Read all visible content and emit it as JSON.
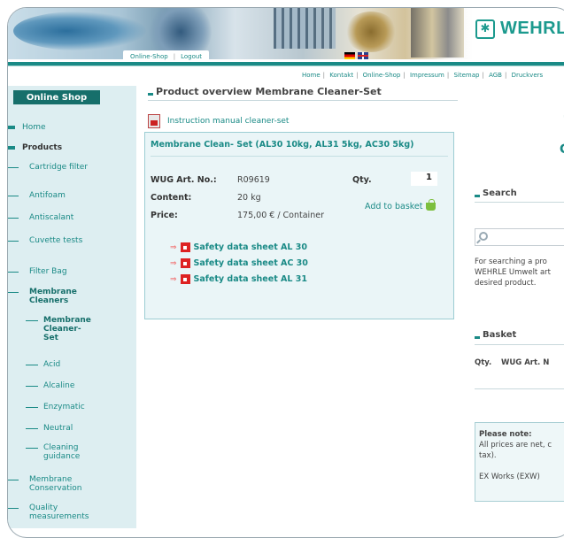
{
  "header": {
    "logo_text": "WEHRLE",
    "top_links": [
      "Online-Shop",
      "Logout"
    ]
  },
  "subnav": [
    "Home",
    "Kontakt",
    "Online-Shop",
    "Impressum",
    "Sitemap",
    "AGB",
    "Druckvers"
  ],
  "sidebar": {
    "heading": "Online Shop",
    "items": [
      {
        "label": "Home",
        "level": 0
      },
      {
        "label": "Products",
        "level": 0
      },
      {
        "label": "Cartridge filter",
        "level": 1
      },
      {
        "label": "Antifoam",
        "level": 1
      },
      {
        "label": "Antiscalant",
        "level": 1
      },
      {
        "label": "Cuvette tests",
        "level": 1
      },
      {
        "label": "Filter Bag",
        "level": 1
      },
      {
        "label": "Membrane Cleaners",
        "level": 1
      },
      {
        "label": "Membrane Cleaner-Set",
        "level": 2
      },
      {
        "label": "Acid",
        "level": 2
      },
      {
        "label": "Alcaline",
        "level": 2
      },
      {
        "label": "Enzymatic",
        "level": 2
      },
      {
        "label": "Neutral",
        "level": 2
      },
      {
        "label": "Cleaning guidance",
        "level": 2
      },
      {
        "label": "Membrane Conservation",
        "level": 1
      },
      {
        "label": "Quality measurements",
        "level": 1
      }
    ]
  },
  "main": {
    "title": "Product overview Membrane Cleaner-Set",
    "manual_link": "Instruction manual cleaner-set",
    "product": {
      "name": "Membrane Clean- Set (AL30 10kg, AL31 5kg, AC30 5kg)",
      "art_label": "WUG Art. No.:",
      "art_value": "R09619",
      "qty_label": "Qty.",
      "qty_value": "1",
      "content_label": "Content:",
      "content_value": "20 kg",
      "price_label": "Price:",
      "price_value": "175,00 € / Container",
      "add_to_basket": "Add to basket"
    },
    "safety_sheets": [
      "Safety data sheet AL 30",
      "Safety data sheet AC 30",
      "Safety data sheet AL 31"
    ]
  },
  "right": {
    "partial_1": "'",
    "partial_2": "C",
    "search_heading": "Search",
    "search_text_1": "For searching a pro",
    "search_text_2": "WEHRLE Umwelt art",
    "search_text_3": "desired product.",
    "basket_heading": "Basket",
    "basket_qty": "Qty.",
    "basket_art": "WUG Art. N",
    "note_title": "Please note:",
    "note_line_1": "All prices are net, c",
    "note_line_2": "tax).",
    "note_line_3": "EX Works (EXW)"
  }
}
